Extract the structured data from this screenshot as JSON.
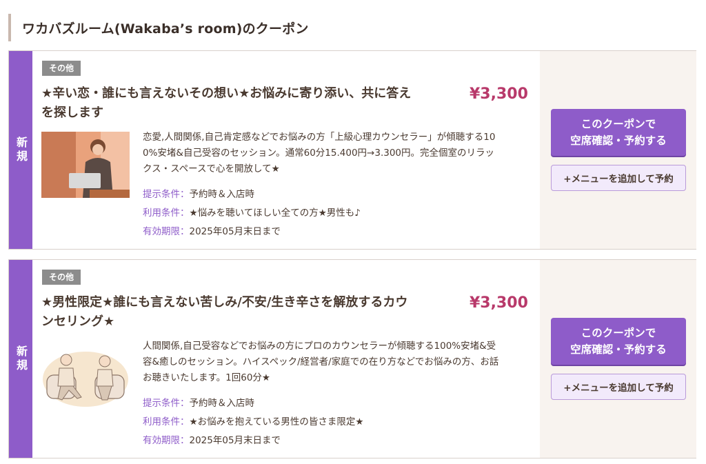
{
  "section": {
    "title": "ワカバズルーム(Wakaba’s room)のクーポン"
  },
  "coupons": [
    {
      "new_label": "新規",
      "category": "その他",
      "title_line1": "★辛い恋・誰にも言えないその想い★お悩みに寄り添い、共に答え",
      "title_line2": "を探します",
      "price": "¥3,300",
      "desc_line1": "恋愛,人間関係,自己肯定感などでお悩みの方「上級心理カウンセラー」が傾聴する10",
      "desc_line2": "0%安堵&自己受容のセッション。通常60分15.400円→3.300円。完全個室のリラッ",
      "desc_line3": "クス・スペースで心を開放して★",
      "present_label": "提示条件：",
      "present_value": "予約時＆入店時",
      "use_label": "利用条件：",
      "use_value": "★悩みを聴いてほしい全ての方★男性も♪",
      "expiry_label": "有効期限：",
      "expiry_value": "2025年05月末日まで",
      "btn_main_line1": "このクーポンで",
      "btn_main_line2": "空席確認・予約する",
      "btn_sub": "+メニューを追加して予約"
    },
    {
      "new_label": "新規",
      "category": "その他",
      "title_line1": "★男性限定★誰にも言えない苦しみ/不安/生き辛さを解放するカウ",
      "title_line2": "ンセリング★",
      "price": "¥3,300",
      "desc_line1": "人間関係,自己受容などでお悩みの方にプロのカウンセラーが傾聴する100%安堵&受",
      "desc_line2": "容&癒しのセッション。ハイスペック/経営者/家庭での在り方などでお悩みの方、お話",
      "desc_line3": "お聴きいたします。1回60分★",
      "present_label": "提示条件：",
      "present_value": "予約時＆入店時",
      "use_label": "利用条件：",
      "use_value": "★お悩みを抱えている男性の皆さま限定★",
      "expiry_label": "有効期限：",
      "expiry_value": "2025年05月末日まで",
      "btn_main_line1": "このクーポンで",
      "btn_main_line2": "空席確認・予約する",
      "btn_sub": "+メニューを追加して予約"
    }
  ]
}
